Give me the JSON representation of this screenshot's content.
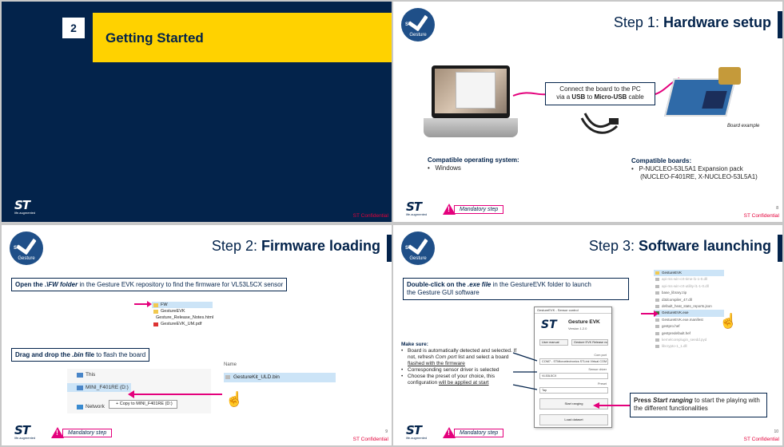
{
  "slide1": {
    "number": "2",
    "title": "Getting Started",
    "logo_tag": "life.augmented",
    "confidential": "ST Confidential"
  },
  "slide2": {
    "badge_st": "ST",
    "badge_text": "Gesture",
    "title_prefix": "Step 1: ",
    "title_bold": "Hardware setup",
    "callout_line1": "Connect the board to the PC",
    "callout_line2_a": "via a ",
    "callout_line2_usb": "USB",
    "callout_line2_b": " to ",
    "callout_line2_micro": "Micro-USB",
    "callout_line2_c": " cable",
    "board_label": "Board example",
    "os_heading": "Compatible operating system:",
    "os_item": "Windows",
    "boards_heading": "Compatible boards:",
    "boards_item1": "P-NUCLEO-53L5A1 Expansion pack",
    "boards_item2": "(NUCLEO-F401RE, X-NUCLEO-53L5A1)",
    "logo_tag": "life.augmented",
    "mandatory": "Mandatory step",
    "page": "8",
    "confidential": "ST Confidential"
  },
  "slide3": {
    "badge_st": "ST",
    "badge_text": "Gesture",
    "title_prefix": "Step 2: ",
    "title_bold": "Firmware loading",
    "instr1_a": "Open the .",
    "instr1_b": "\\FW folder",
    "instr1_c": " in the Gesture EVK repository to find the firmware for VL53L5CX sensor",
    "files": [
      "FW",
      "GestureEVK",
      "Gesture_Release_Notes.html",
      "GestureEVK_UM.pdf"
    ],
    "instr2_a": "Drag and drop the ",
    "instr2_b": ".bin",
    "instr2_c": " file",
    "instr2_d": " to flash the board",
    "tree_this": "This",
    "tree_drive": "MINI_F401RE (D:)",
    "tree_network": "Network",
    "copy_tip": "+ Copy to MINI_F401RE (D:)",
    "name_col": "Name",
    "bin_file": "GestureKit_ULD.bin",
    "logo_tag": "life.augmented",
    "mandatory": "Mandatory step",
    "page": "9",
    "confidential": "ST Confidential"
  },
  "slide4": {
    "badge_st": "ST",
    "badge_text": "Gesture",
    "title_prefix": "Step 3: ",
    "title_bold": "Software launching",
    "instr_a": "Double-click on the ",
    "instr_b": ".exe file",
    "instr_c": " in the GestureEVK folder to launch",
    "instr_d": "the Gesture GUI software",
    "evk": {
      "window_title": "GestureEVK - Sensor control",
      "logo": "ST",
      "name": "Gesture EVK",
      "version": "Version 1.2.0",
      "btn_manual": "User manual",
      "btn_release": "Gesture EVK Release notes",
      "com_label": "Com port",
      "com_value": "COM7 - STMicroelectronics STLink Virtual COM",
      "driver_label": "Sensor driver",
      "driver_value": "VL53L5CX",
      "preset_label": "Preset",
      "preset_value": "Tap",
      "start": "Start ranging",
      "load": "Load dataset"
    },
    "make_sure": "Make sure:",
    "ms1_a": "Board is automatically detected and selected. If not, refresh ",
    "ms1_b": "Com port",
    "ms1_c": " list and select a board ",
    "ms1_d": "flashed with the firmware",
    "ms2": "Corresponding sensor driver is selected",
    "ms3_a": "Choose the preset of your choice, this configuration ",
    "ms3_b": "will be applied at start",
    "folder_rows": [
      "GestureEVK",
      "api-ms-win-crt-time-l1-1-0.dll",
      "api-ms-win-crt-utility-l1-1-0.dll",
      "base_library.zip",
      "d3dcompiler_47.dll",
      "default_heat_stats_reports.json",
      "GestureEVK.exe",
      "GestureEVK.exe.manifest",
      "gestpro.hef",
      "gestpredefault.hef",
      "kernelcoreplugin_seedd.pyd",
      "libcrypto-1_1.dll"
    ],
    "press_a": "Press ",
    "press_b": "Start ranging",
    "press_c": " to start the playing with the different functionalities",
    "logo_tag": "life.augmented",
    "mandatory": "Mandatory step",
    "page": "10",
    "confidential": "ST Confidential"
  },
  "colors": {
    "navy": "#03234b",
    "yellow": "#ffd200",
    "magenta": "#e4007c",
    "red": "#e4003a"
  }
}
